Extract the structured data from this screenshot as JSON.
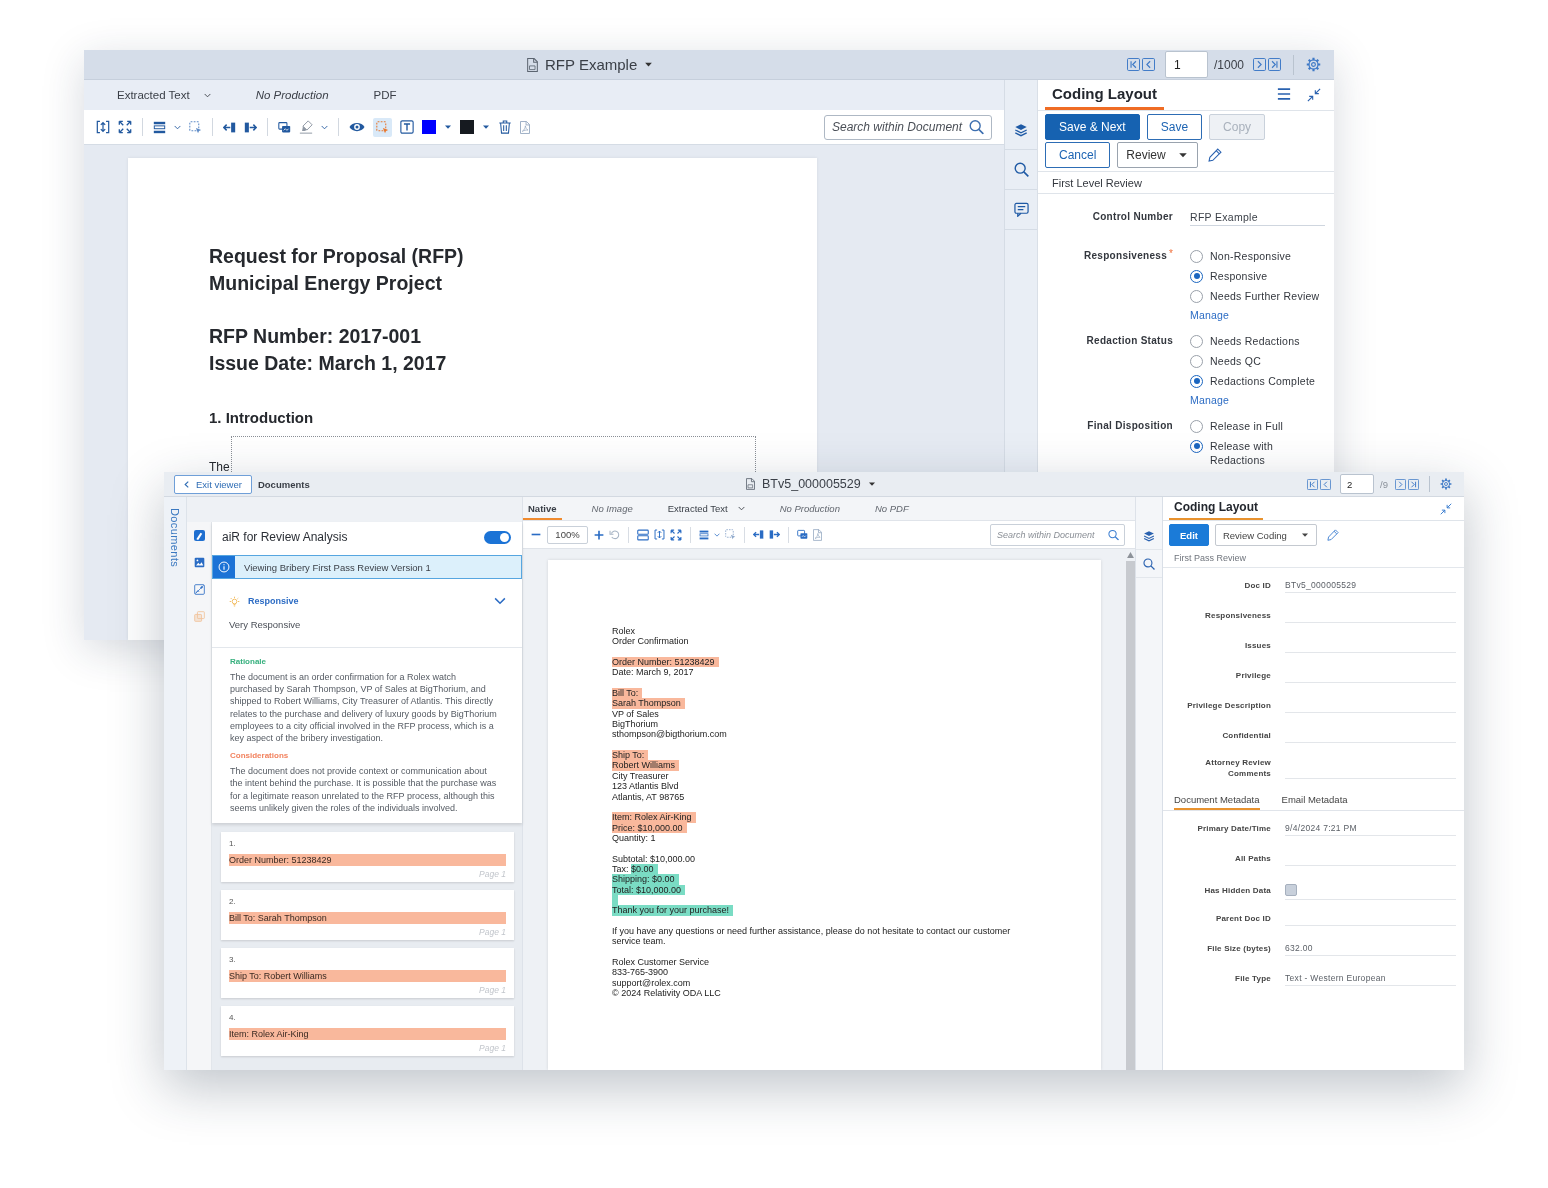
{
  "back_window": {
    "title": "RFP Example",
    "pager": {
      "page": "1",
      "total": "/1000"
    },
    "view_tabs": [
      {
        "label": "Extracted Text",
        "kind": "menu",
        "selected": false
      },
      {
        "label": "No Production",
        "kind": "unavailable",
        "selected": false
      },
      {
        "label": "PDF",
        "kind": "plain",
        "selected": false
      }
    ],
    "toolbar": {
      "selection_tool_active": true,
      "swatches": [
        {
          "color": "#0000ff"
        },
        {
          "color": "#161a20"
        }
      ]
    },
    "search": {
      "placeholder": "Search within Document"
    },
    "document": {
      "title_lines": [
        "Request for Proposal (RFP)",
        "Municipal Energy Project"
      ],
      "meta_lines": [
        "RFP Number: 2017-001",
        "Issue Date: March 1, 2017"
      ],
      "section_heading": "1. Introduction",
      "body_start": "The"
    },
    "coding_panel": {
      "tab": {
        "label": "Coding Layout",
        "selected": true
      },
      "button_rows": [
        [
          {
            "label": "Save & Next",
            "kind": "primary",
            "disabled": false
          },
          {
            "label": "Save",
            "kind": "outline",
            "disabled": false
          },
          {
            "label": "Copy",
            "kind": "outline",
            "disabled": true
          }
        ],
        [
          {
            "label": "Cancel",
            "kind": "outline",
            "disabled": false
          },
          {
            "label": "Review",
            "kind": "dropdown",
            "disabled": false
          }
        ]
      ],
      "section": "First Level Review",
      "fields": [
        {
          "label": "Control Number",
          "kind": "text",
          "value": "RFP Example"
        },
        {
          "label": "Responsiveness",
          "required_mark": "*",
          "kind": "radio",
          "options": [
            {
              "label": "Non-Responsive",
              "selected": false
            },
            {
              "label": "Responsive",
              "selected": true
            },
            {
              "label": "Needs Further Review",
              "selected": false
            }
          ],
          "link": "Manage"
        },
        {
          "label": "Redaction Status",
          "kind": "radio",
          "options": [
            {
              "label": "Needs Redactions",
              "selected": false
            },
            {
              "label": "Needs QC",
              "selected": false
            },
            {
              "label": "Redactions Complete",
              "selected": true
            }
          ],
          "link": "Manage"
        },
        {
          "label": "Final Disposition",
          "kind": "radio",
          "options": [
            {
              "label": "Release in Full",
              "selected": false
            },
            {
              "label": "Release with Redactions",
              "selected": true
            }
          ]
        }
      ]
    }
  },
  "front_window": {
    "exit_button": "Exit viewer",
    "breadcrumb": "Documents",
    "title": "BTv5_000005529",
    "pager": {
      "page": "2",
      "total": "/9"
    },
    "side_tab": "Documents",
    "air_panel": {
      "title": "aiR for Review Analysis",
      "on": true,
      "notice": "Viewing Bribery First Pass Review Version 1",
      "result": {
        "label": "Responsive",
        "detail": "Very Responsive"
      },
      "rationale": {
        "heading": "Rationale",
        "text": "The document is an order confirmation for a Rolex watch purchased by Sarah Thompson, VP of Sales at BigThorium, and shipped to Robert Williams, City Treasurer of Atlantis. This directly relates to the purchase and delivery of luxury goods by BigThorium employees to a city official involved in the RFP process, which is a key aspect of the bribery investigation."
      },
      "considerations": {
        "heading": "Considerations",
        "text": "The document does not provide context or communication about the intent behind the purchase. It is possible that the purchase was for a legitimate reason unrelated to the RFP process, although this seems unlikely given the roles of the individuals involved."
      },
      "citations": [
        {
          "number": "1.",
          "text": "Order Number: 51238429",
          "page": "Page 1"
        },
        {
          "number": "2.",
          "text": "Bill To: Sarah Thompson",
          "page": "Page 1"
        },
        {
          "number": "3.",
          "text": "Ship To: Robert Williams",
          "page": "Page 1"
        },
        {
          "number": "4.",
          "text": "Item: Rolex Air-King",
          "page": "Page 1"
        }
      ]
    },
    "view_tabs": [
      {
        "label": "Native",
        "kind": "plain",
        "selected": true
      },
      {
        "label": "No Image",
        "kind": "unavailable",
        "selected": false
      },
      {
        "label": "Extracted Text",
        "kind": "menu",
        "selected": false
      },
      {
        "label": "No Production",
        "kind": "unavailable",
        "selected": false
      },
      {
        "label": "No PDF",
        "kind": "unavailable",
        "selected": false
      }
    ],
    "zoom": "100%",
    "search": {
      "placeholder": "Search within Document"
    },
    "document": {
      "paragraphs": [
        {
          "lines": [
            [
              {
                "text": "Rolex"
              }
            ],
            [
              {
                "text": "Order Confirmation"
              }
            ]
          ]
        },
        {
          "lines": [
            [
              {
                "text": "Order Number: 51238429",
                "color": "#f9b89c"
              }
            ],
            [
              {
                "text": "Date: March 9, 2017"
              }
            ]
          ]
        },
        {
          "lines": [
            [
              {
                "text": "Bill To:",
                "color": "#f9b89c"
              }
            ],
            [
              {
                "text": "Sarah Thompson",
                "color": "#f9b89c"
              }
            ],
            [
              {
                "text": "VP of Sales"
              }
            ],
            [
              {
                "text": "BigThorium"
              }
            ],
            [
              {
                "text": "sthompson@bigthorium.com"
              }
            ]
          ]
        },
        {
          "lines": [
            [
              {
                "text": "Ship To:",
                "color": "#f9b89c"
              }
            ],
            [
              {
                "text": "Robert Williams",
                "color": "#f9b89c"
              }
            ],
            [
              {
                "text": "City Treasurer"
              }
            ],
            [
              {
                "text": "123 Atlantis Blvd"
              }
            ],
            [
              {
                "text": "Atlantis, AT 98765"
              }
            ]
          ]
        },
        {
          "lines": [
            [
              {
                "text": "Item: Rolex Air-King",
                "color": "#f9b89c"
              }
            ],
            [
              {
                "text": "Price: $10,000.00",
                "color": "#f9b89c"
              }
            ],
            [
              {
                "text": "Quantity: 1"
              }
            ]
          ]
        },
        {
          "lines": [
            [
              {
                "text": "Subtotal: $10,000.00"
              }
            ],
            [
              {
                "text": "Tax:"
              },
              {
                "text": "$0.00",
                "color": "#7adcc4"
              }
            ],
            [
              {
                "text": "Shipping: $0.00",
                "color": "#7adcc4"
              }
            ],
            [
              {
                "text": "Total: $10,000.00",
                "color": "#7adcc4"
              }
            ],
            [
              {
                "color": "#7adcc4"
              }
            ],
            [
              {
                "text": "Thank you for your purchase!",
                "color": "#7adcc4"
              }
            ]
          ]
        },
        {
          "lines": [
            [
              {
                "text": "If you have any questions or need further assistance, please do not hesitate to contact our customer service team."
              }
            ]
          ]
        },
        {
          "lines": [
            [
              {
                "text": "Rolex Customer Service"
              }
            ],
            [
              {
                "text": "833-765-3900"
              }
            ],
            [
              {
                "text": "support@rolex.com"
              }
            ],
            [
              {
                "text": "© 2024 Relativity ODA LLC"
              }
            ]
          ]
        }
      ]
    },
    "coding_panel": {
      "tab": {
        "label": "Coding Layout",
        "selected": true
      },
      "button_rows": [
        [
          {
            "label": "Edit",
            "kind": "primary",
            "disabled": false
          },
          {
            "label": "Review Coding",
            "kind": "dropdown",
            "disabled": false
          }
        ]
      ],
      "section": "First Pass Review",
      "fields": [
        {
          "label": "Doc ID",
          "kind": "text",
          "value": "BTv5_000005529"
        },
        {
          "label": "Responsiveness",
          "kind": "text"
        },
        {
          "label": "Issues",
          "kind": "text"
        },
        {
          "label": "Privilege",
          "kind": "text"
        },
        {
          "label": "Privilege Description",
          "kind": "text"
        },
        {
          "label": "Confidential",
          "kind": "text"
        },
        {
          "label": "Attorney Review Comments",
          "kind": "text"
        }
      ],
      "metadata_tabs": [
        {
          "label": "Document Metadata",
          "selected": true
        },
        {
          "label": "Email Metadata",
          "selected": false
        }
      ],
      "metadata_fields": [
        {
          "label": "Primary Date/Time",
          "kind": "text",
          "value": "9/4/2024 7:21 PM"
        },
        {
          "label": "All Paths",
          "kind": "text"
        },
        {
          "label": "Has Hidden Data",
          "kind": "checkbox",
          "checked": false
        },
        {
          "label": "Parent Doc ID",
          "kind": "text"
        },
        {
          "label": "File Size (bytes)",
          "kind": "text",
          "value": "632.00"
        },
        {
          "label": "File Type",
          "kind": "text",
          "value": "Text - Western European"
        }
      ]
    }
  }
}
